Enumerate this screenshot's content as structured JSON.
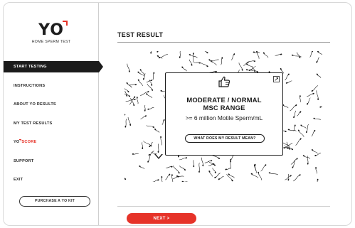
{
  "brand": {
    "logo_text": "YO",
    "tagline": "HOME SPERM TEST",
    "accent_color": "#e63329"
  },
  "sidebar": {
    "items": [
      {
        "label": "START TESTING",
        "active": true
      },
      {
        "label": "INSTRUCTIONS",
        "active": false
      },
      {
        "label": "ABOUT YO RESULTS",
        "active": false
      },
      {
        "label": "MY TEST RESULTS",
        "active": false
      },
      {
        "label_prefix": "YO",
        "label_suffix": "SCORE",
        "active": false
      },
      {
        "label": "SUPPORT",
        "active": false
      },
      {
        "label": "EXIT",
        "active": false
      }
    ],
    "purchase_label": "PURCHASE A YO KIT"
  },
  "main": {
    "title": "TEST RESULT",
    "result": {
      "line1": "MODERATE / NORMAL",
      "line2": "MSC RANGE",
      "description": ">= 6 million Motile Sperm/mL",
      "meaning_label": "WHAT DOES MY RESULT MEAN?",
      "icon": "thumbs-up-icon",
      "corner_icon": "expand-icon"
    },
    "next_label": "NEXT >"
  }
}
